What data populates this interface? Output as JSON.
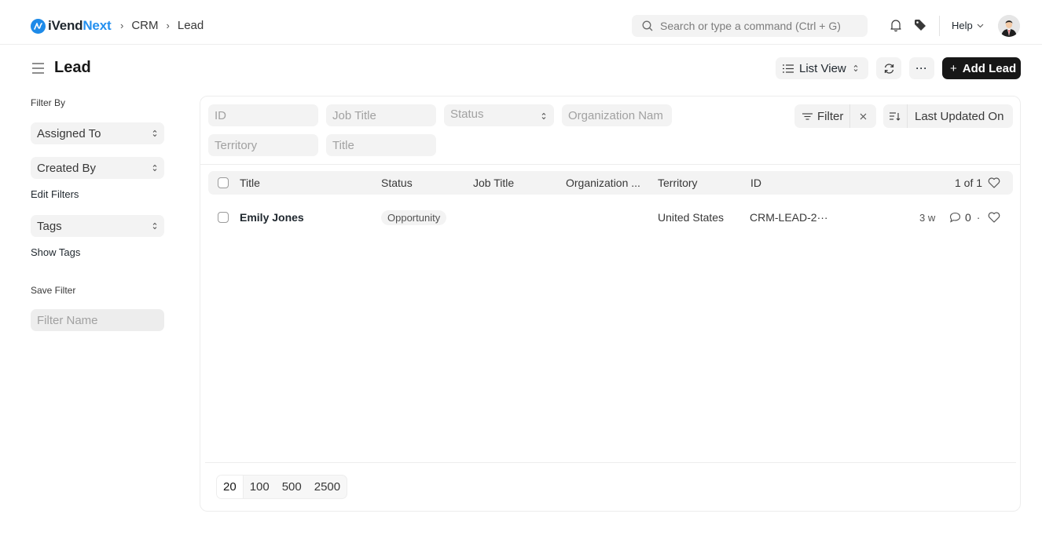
{
  "navbar": {
    "brand_prefix": "iVend",
    "brand_suffix": "Next",
    "breadcrumbs": [
      "CRM",
      "Lead"
    ],
    "search_placeholder": "Search or type a command (Ctrl + G)",
    "help_label": "Help",
    "icons": {
      "search": "search-icon",
      "notifications": "bell-icon",
      "tags": "tag-icon",
      "help_chevron": "chevron-down-icon"
    }
  },
  "page": {
    "title": "Lead",
    "view_selector": "List View",
    "more_label": "···",
    "add_button": "Add Lead",
    "add_button_prefix": "+"
  },
  "sidebar": {
    "filter_by_label": "Filter By",
    "filters": [
      "Assigned To",
      "Created By"
    ],
    "edit_filters": "Edit Filters",
    "tags_select": "Tags",
    "show_tags": "Show Tags",
    "save_filter_label": "Save Filter",
    "filter_name_placeholder": "Filter Name"
  },
  "filters": {
    "fields": [
      {
        "placeholder": "ID"
      },
      {
        "placeholder": "Job Title"
      },
      {
        "placeholder": "Status",
        "type": "select"
      },
      {
        "placeholder": "Organization Nam"
      },
      {
        "placeholder": "Territory"
      },
      {
        "placeholder": "Title"
      }
    ],
    "filter_button": "Filter",
    "clear_icon": "close-icon",
    "sort_label": "Last Updated On"
  },
  "table": {
    "columns": [
      "Title",
      "Status",
      "Job Title",
      "Organization ...",
      "Territory",
      "ID"
    ],
    "count_label": "1 of 1",
    "rows": [
      {
        "title": "Emily Jones",
        "status": "Opportunity",
        "job_title": "",
        "organization": "",
        "territory": "United States",
        "id": "CRM-LEAD-2···",
        "modified": "3 w",
        "comments": "0",
        "separator": "·"
      }
    ]
  },
  "pagination": {
    "options": [
      "20",
      "100",
      "500",
      "2500"
    ],
    "selected": "20"
  },
  "colors": {
    "brand_blue": "#2490ef",
    "primary_button": "#171717",
    "control_bg": "#f3f3f3"
  }
}
